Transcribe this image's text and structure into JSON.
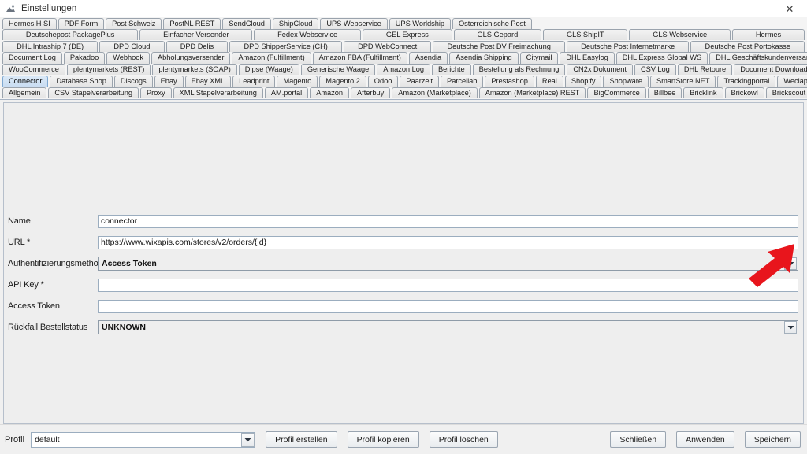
{
  "window": {
    "title": "Einstellungen",
    "app_icon": "settings-app-icon",
    "close_icon": "close-icon"
  },
  "tab_rows": [
    {
      "row_index": 0,
      "tabs": [
        {
          "label": "Hermes H SI",
          "selected": false
        },
        {
          "label": "PDF Form",
          "selected": false
        },
        {
          "label": "Post Schweiz",
          "selected": false
        },
        {
          "label": "PostNL REST",
          "selected": false
        },
        {
          "label": "SendCloud",
          "selected": false
        },
        {
          "label": "ShipCloud",
          "selected": false
        },
        {
          "label": "UPS Webservice",
          "selected": false
        },
        {
          "label": "UPS Worldship",
          "selected": false
        },
        {
          "label": "Österreichische Post",
          "selected": false
        }
      ]
    },
    {
      "row_index": 1,
      "tabs": [
        {
          "label": "Deutschepost PackagePlus",
          "selected": false,
          "stretch": true
        },
        {
          "label": "Einfacher Versender",
          "selected": false,
          "stretch": true
        },
        {
          "label": "Fedex Webservice",
          "selected": false,
          "stretch": true
        },
        {
          "label": "GEL Express",
          "selected": false,
          "stretch": true
        },
        {
          "label": "GLS Gepard",
          "selected": false,
          "stretch": true
        },
        {
          "label": "GLS ShipIT",
          "selected": false,
          "stretch": true
        },
        {
          "label": "GLS Webservice",
          "selected": false,
          "stretch": true
        },
        {
          "label": "Hermes",
          "selected": false,
          "stretch": true
        }
      ]
    },
    {
      "row_index": 2,
      "tabs": [
        {
          "label": "DHL Intraship 7 (DE)",
          "selected": false,
          "stretch": true
        },
        {
          "label": "DPD Cloud",
          "selected": false,
          "stretch": true
        },
        {
          "label": "DPD Delis",
          "selected": false,
          "stretch": true
        },
        {
          "label": "DPD ShipperService (CH)",
          "selected": false,
          "stretch": true
        },
        {
          "label": "DPD WebConnect",
          "selected": false,
          "stretch": true
        },
        {
          "label": "Deutsche Post DV Freimachung",
          "selected": false,
          "stretch": true
        },
        {
          "label": "Deutsche Post Internetmarke",
          "selected": false,
          "stretch": true
        },
        {
          "label": "Deutsche Post Portokasse",
          "selected": false,
          "stretch": true
        }
      ]
    },
    {
      "row_index": 3,
      "tabs": [
        {
          "label": "Document Log",
          "selected": false
        },
        {
          "label": "Pakadoo",
          "selected": false
        },
        {
          "label": "Webhook",
          "selected": false
        },
        {
          "label": "Abholungsversender",
          "selected": false
        },
        {
          "label": "Amazon (Fulfillment)",
          "selected": false
        },
        {
          "label": "Amazon FBA (Fulfillment)",
          "selected": false
        },
        {
          "label": "Asendia",
          "selected": false
        },
        {
          "label": "Asendia Shipping",
          "selected": false
        },
        {
          "label": "Citymail",
          "selected": false
        },
        {
          "label": "DHL Easylog",
          "selected": false
        },
        {
          "label": "DHL Express Global WS",
          "selected": false
        },
        {
          "label": "DHL Geschäftskundenversand",
          "selected": false
        }
      ]
    },
    {
      "row_index": 4,
      "tabs": [
        {
          "label": "WooCommerce",
          "selected": false
        },
        {
          "label": "plentymarkets (REST)",
          "selected": false
        },
        {
          "label": "plentymarkets (SOAP)",
          "selected": false
        },
        {
          "label": "Dipse (Waage)",
          "selected": false
        },
        {
          "label": "Generische Waage",
          "selected": false
        },
        {
          "label": "Amazon Log",
          "selected": false
        },
        {
          "label": "Berichte",
          "selected": false
        },
        {
          "label": "Bestellung als Rechnung",
          "selected": false
        },
        {
          "label": "CN2x Dokument",
          "selected": false
        },
        {
          "label": "CSV Log",
          "selected": false
        },
        {
          "label": "DHL Retoure",
          "selected": false
        },
        {
          "label": "Document Downloader",
          "selected": false
        }
      ]
    },
    {
      "row_index": 5,
      "tabs": [
        {
          "label": "Connector",
          "selected": true
        },
        {
          "label": "Database Shop",
          "selected": false
        },
        {
          "label": "Discogs",
          "selected": false
        },
        {
          "label": "Ebay",
          "selected": false
        },
        {
          "label": "Ebay XML",
          "selected": false
        },
        {
          "label": "Leadprint",
          "selected": false
        },
        {
          "label": "Magento",
          "selected": false
        },
        {
          "label": "Magento 2",
          "selected": false
        },
        {
          "label": "Odoo",
          "selected": false
        },
        {
          "label": "Paarzeit",
          "selected": false
        },
        {
          "label": "Parcellab",
          "selected": false
        },
        {
          "label": "Prestashop",
          "selected": false
        },
        {
          "label": "Real",
          "selected": false
        },
        {
          "label": "Shopify",
          "selected": false
        },
        {
          "label": "Shopware",
          "selected": false
        },
        {
          "label": "SmartStore.NET",
          "selected": false
        },
        {
          "label": "Trackingportal",
          "selected": false
        },
        {
          "label": "Weclapp",
          "selected": false
        }
      ]
    },
    {
      "row_index": 6,
      "tabs": [
        {
          "label": "Allgemein",
          "selected": false
        },
        {
          "label": "CSV Stapelverarbeitung",
          "selected": false
        },
        {
          "label": "Proxy",
          "selected": false
        },
        {
          "label": "XML Stapelverarbeitung",
          "selected": false
        },
        {
          "label": "AM.portal",
          "selected": false
        },
        {
          "label": "Amazon",
          "selected": false
        },
        {
          "label": "Afterbuy",
          "selected": false
        },
        {
          "label": "Amazon (Marketplace)",
          "selected": false
        },
        {
          "label": "Amazon (Marketplace) REST",
          "selected": false
        },
        {
          "label": "BigCommerce",
          "selected": false
        },
        {
          "label": "Billbee",
          "selected": false
        },
        {
          "label": "Bricklink",
          "selected": false
        },
        {
          "label": "Brickowl",
          "selected": false
        },
        {
          "label": "Brickscout",
          "selected": false
        }
      ]
    }
  ],
  "form": {
    "fields": [
      {
        "label": "Name",
        "type": "text",
        "value": "connector",
        "name": "name-field"
      },
      {
        "label": "URL *",
        "type": "text",
        "value": "https://www.wixapis.com/stores/v2/orders/{id}",
        "name": "url-field"
      },
      {
        "label": "Authentifizierungsmethode",
        "type": "combo",
        "value": "Access Token",
        "name": "auth-method-combo"
      },
      {
        "label": "API Key *",
        "type": "text",
        "value": "",
        "name": "api-key-field"
      },
      {
        "label": "Access Token",
        "type": "text",
        "value": "",
        "name": "access-token-field"
      },
      {
        "label": "Rückfall Bestellstatus",
        "type": "combo",
        "value": "UNKNOWN",
        "name": "fallback-order-status-combo"
      }
    ]
  },
  "annotation": {
    "arrow_color": "#e8151c",
    "arrow_target": "auth-method-combo-arrow"
  },
  "bottom_bar": {
    "profil_label": "Profil",
    "profil_value": "default",
    "buttons_left": [
      {
        "label": "Profil erstellen",
        "name": "create-profile-button"
      },
      {
        "label": "Profil kopieren",
        "name": "copy-profile-button"
      },
      {
        "label": "Profil löschen",
        "name": "delete-profile-button"
      }
    ],
    "buttons_right": [
      {
        "label": "Schließen",
        "name": "close-button"
      },
      {
        "label": "Anwenden",
        "name": "apply-button"
      },
      {
        "label": "Speichern",
        "name": "save-button"
      }
    ]
  }
}
